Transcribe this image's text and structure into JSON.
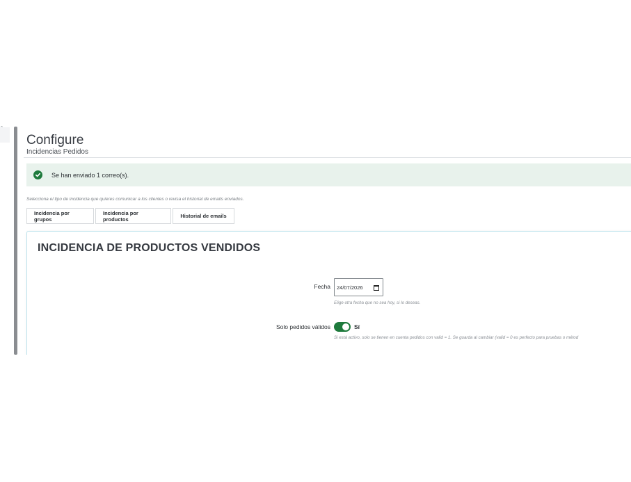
{
  "header": {
    "title": "Configure",
    "subtitle": "Incidencias Pedidos"
  },
  "alert": {
    "icon": "check-circle-icon",
    "message": "Se han enviado 1 correo(s).",
    "color": "#1e7a3c"
  },
  "intro": "Selecciona el tipo de incidencia que quieres comunicar a los clientes o revisa el historial de emails enviados.",
  "tabs": [
    {
      "label": "Incidencia por grupos"
    },
    {
      "label": "Incidencia por productos"
    },
    {
      "label": "Historial de emails"
    }
  ],
  "panel": {
    "title": "INCIDENCIA DE PRODUCTOS VENDIDOS",
    "fecha": {
      "label": "Fecha",
      "value": "24/07/2026",
      "help": "Elige otra fecha que no sea hoy, si lo deseas."
    },
    "solo_validos": {
      "label": "Solo pedidos válidos",
      "state_label": "Sí",
      "enabled": true,
      "help": "Si está activo, solo se tienen en cuenta pedidos con valid = 1. Se guarda al cambiar (valid = 0 es perfecto para pruebas o métod"
    }
  }
}
